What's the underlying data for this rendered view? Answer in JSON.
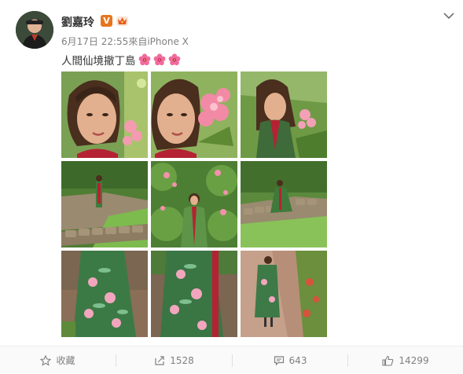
{
  "post": {
    "author": "劉嘉玲",
    "verified_badge": "V",
    "time": "6月17日 22:55",
    "source_prefix": "來自",
    "source": "iPhone X",
    "text": "人間仙境撤丁島",
    "emoji_count": 3,
    "emoji_icon": "hibiscus-flower-icon",
    "photos": [
      {
        "name": "photo-1",
        "icon": "portrait-closeup"
      },
      {
        "name": "photo-2",
        "icon": "portrait-flowers"
      },
      {
        "name": "photo-3",
        "icon": "portrait-garden"
      },
      {
        "name": "photo-4",
        "icon": "garden-path"
      },
      {
        "name": "photo-5",
        "icon": "standing-in-flowers"
      },
      {
        "name": "photo-6",
        "icon": "sitting-on-wall"
      },
      {
        "name": "photo-7",
        "icon": "dress-closeup"
      },
      {
        "name": "photo-8",
        "icon": "walking-back-view"
      },
      {
        "name": "photo-9",
        "icon": "walking-on-path"
      }
    ]
  },
  "actions": {
    "favorite_label": "收藏",
    "repost_count": "1528",
    "comment_count": "643",
    "like_count": "14299"
  },
  "colors": {
    "badge": "#e6761d",
    "text_muted": "#808080",
    "text_main": "#333333"
  }
}
